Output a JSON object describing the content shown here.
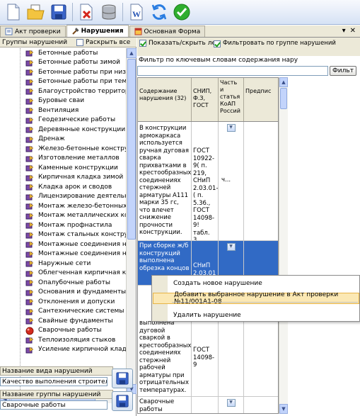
{
  "toolbar": {
    "buttons": [
      "new-document-icon",
      "open-folder-icon",
      "save-icon",
      "delete-document-icon",
      "database-icon",
      "word-export-icon",
      "refresh-icon",
      "confirm-icon"
    ]
  },
  "tabs": [
    {
      "label": "Акт проверки"
    },
    {
      "label": "Нарушения"
    },
    {
      "label": "Основная Форма"
    }
  ],
  "tab_controls": {
    "pin": "▾",
    "close": "✕"
  },
  "left_panel": {
    "title": "Группы нарушений",
    "expand_all_label": "Раскрыть все",
    "tree_items": [
      "Бетонные работы",
      "Бетонные работы зимой",
      "Бетонные работы при низких",
      "Бетонные работы при темпер",
      "Благоустройство территории",
      "Буровые сваи",
      "Вентиляция",
      "Геодезические работы",
      "Деревянные конструкции",
      "Дренаж",
      "Железо-бетонные конструк",
      "Изготовление металлов",
      "Каменные конструкции",
      "Кирпичная кладка зимой",
      "Кладка арок и сводов",
      "Лицензирование деятельнос",
      "Монтаж железо-бетонных к",
      "Монтаж металлических кон",
      "Монтаж профнастила",
      "Монтаж стальных конструк",
      "Монтажные соединения на",
      "Монтажные соединения на",
      "Наружные сети",
      "Облегченная кирпичная клад",
      "Опалубочные работы",
      "Основания и фундаменты",
      "Отклонения и допуски",
      "Сантехнические системы",
      "Свайные фундаменты",
      "Сварочные работы",
      "Теплоизоляция стыков",
      "Усиление кирпичной кладк"
    ],
    "violation_name_label": "Название вида нарушений",
    "violation_name_value": "Качество выполнения строительн",
    "group_name_label": "Название группы нарушений",
    "group_name_value": "Сварочные работы"
  },
  "right_panel": {
    "show_hide_label": "Показать/скрыть ле",
    "filter_by_group_label": "Фильтровать по группе нарушений",
    "keyword_filter_label": "Фильтр по ключевым словам содержания нару",
    "keyword_filter_value": "",
    "filter_button": "Фильт",
    "columns": [
      "Содержание нарушения (32)",
      "СНИП, Ф.З, ГОСТ",
      "Часть и статья КоАП Россий",
      "Предпис"
    ],
    "rows": [
      {
        "content": "В конструкции армокаркаса используется ручная дуговая сварка прихватками в крестообразных соединениях стержней арматуры А111 марки 35 гс, что влечет снижение прочности конструкции.",
        "snip": "ГОСТ 10922-9( п. 219, СНиП 2.03.01-( п. 5.36., ГОСТ 14098-9! табл. 3.",
        "koap": "ч..."
      },
      {
        "content": "При сборке ж/б конструкций выполнена обрезка концов",
        "snip": "СНиП 2.03.01",
        "koap": ""
      },
      {
        "content": "выполнена дуговой сваркой в крестообразных соединениях стержней рабочей арматуры при отрицательных температурах.",
        "snip": "ГОСТ 14098-9",
        "koap": ""
      },
      {
        "content": "Сварочные работы",
        "snip": "",
        "koap": ""
      }
    ]
  },
  "context_menu": {
    "items": [
      "Создать новое нарушение",
      "Добавить выбранное нарушение в Акт проверки №11/001А1-08",
      "Удалить нарушение"
    ]
  },
  "colors": {
    "selection": "#316ac5",
    "menu_highlight": "#fbe8b4",
    "panel": "#ece9d8"
  }
}
